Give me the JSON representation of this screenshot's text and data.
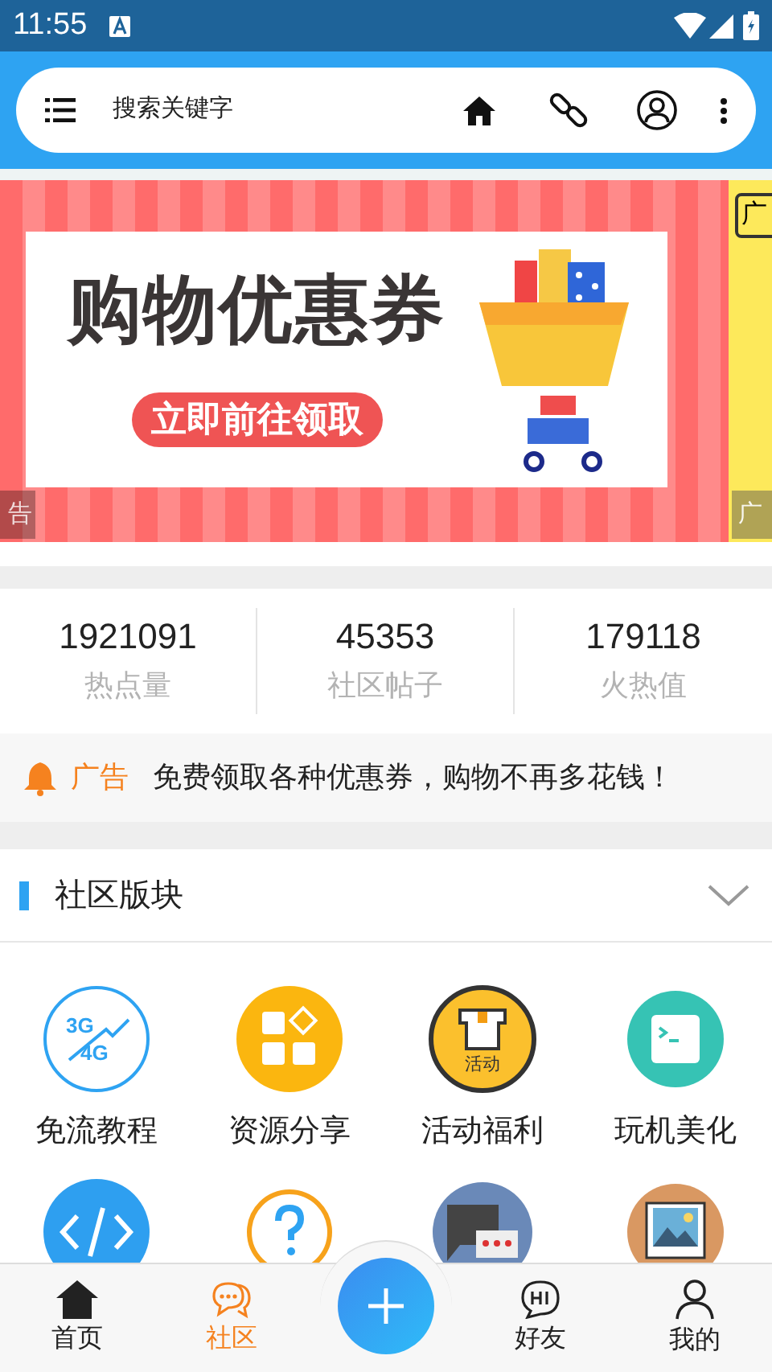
{
  "status_bar": {
    "time": "11:55"
  },
  "search": {
    "placeholder": "搜索关键字"
  },
  "banner": {
    "headline": "购物优惠券",
    "button": "立即前往领取",
    "left_tag": "告",
    "right_tag_top": "广",
    "right_tag_bottom": "广"
  },
  "stats": [
    {
      "value": "1921091",
      "label": "热点量"
    },
    {
      "value": "45353",
      "label": "社区帖子"
    },
    {
      "value": "179118",
      "label": "火热值"
    }
  ],
  "notice": {
    "tag": "广告",
    "text": "免费领取各种优惠券，购物不再多花钱！"
  },
  "section": {
    "title": "社区版块",
    "expanded": true
  },
  "boards": [
    {
      "kind": "network",
      "label": "免流教程",
      "icon_text": [
        "3G",
        "4G"
      ]
    },
    {
      "kind": "apps",
      "label": "资源分享"
    },
    {
      "kind": "gift",
      "label": "活动福利",
      "icon_text": [
        "活动"
      ]
    },
    {
      "kind": "terminal",
      "label": "玩机美化"
    },
    {
      "kind": "code"
    },
    {
      "kind": "question"
    },
    {
      "kind": "chat"
    },
    {
      "kind": "image"
    }
  ],
  "tabs": [
    {
      "kind": "home",
      "label": "首页",
      "selected": false
    },
    {
      "kind": "community",
      "label": "社区",
      "selected": true
    },
    {
      "kind": "friends",
      "label": "好友",
      "selected": false
    },
    {
      "kind": "me",
      "label": "我的",
      "selected": false
    }
  ]
}
